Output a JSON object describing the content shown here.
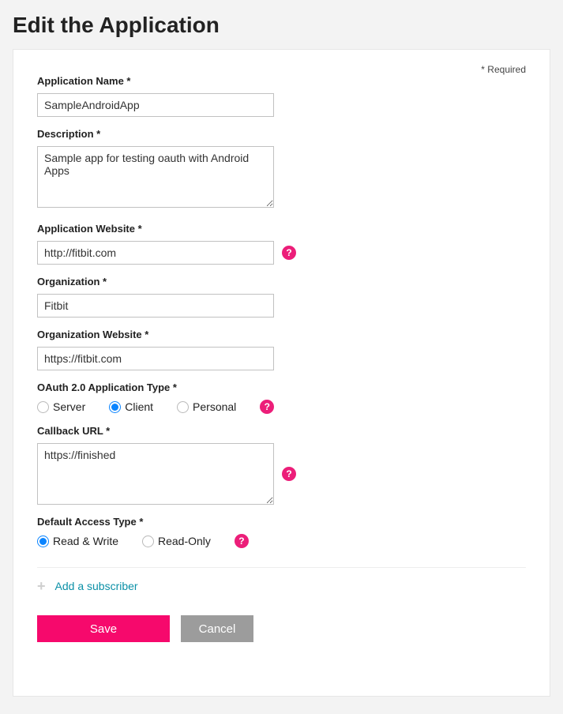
{
  "page": {
    "title": "Edit the Application",
    "required_note": "* Required"
  },
  "form": {
    "application_name": {
      "label": "Application Name *",
      "value": "SampleAndroidApp"
    },
    "description": {
      "label": "Description *",
      "value": "Sample app for testing oauth with Android Apps"
    },
    "application_website": {
      "label": "Application Website *",
      "value": "http://fitbit.com"
    },
    "organization": {
      "label": "Organization *",
      "value": "Fitbit"
    },
    "organization_website": {
      "label": "Organization Website *",
      "value": "https://fitbit.com"
    },
    "oauth_type": {
      "label": "OAuth 2.0 Application Type *",
      "options": {
        "server": "Server",
        "client": "Client",
        "personal": "Personal"
      },
      "selected": "client"
    },
    "callback_url": {
      "label": "Callback URL *",
      "value": "https://finished"
    },
    "access_type": {
      "label": "Default Access Type *",
      "options": {
        "rw": "Read & Write",
        "ro": "Read-Only"
      },
      "selected": "rw"
    }
  },
  "actions": {
    "add_subscriber": "Add a subscriber",
    "save": "Save",
    "cancel": "Cancel"
  },
  "icons": {
    "help": "?",
    "plus": "+"
  }
}
